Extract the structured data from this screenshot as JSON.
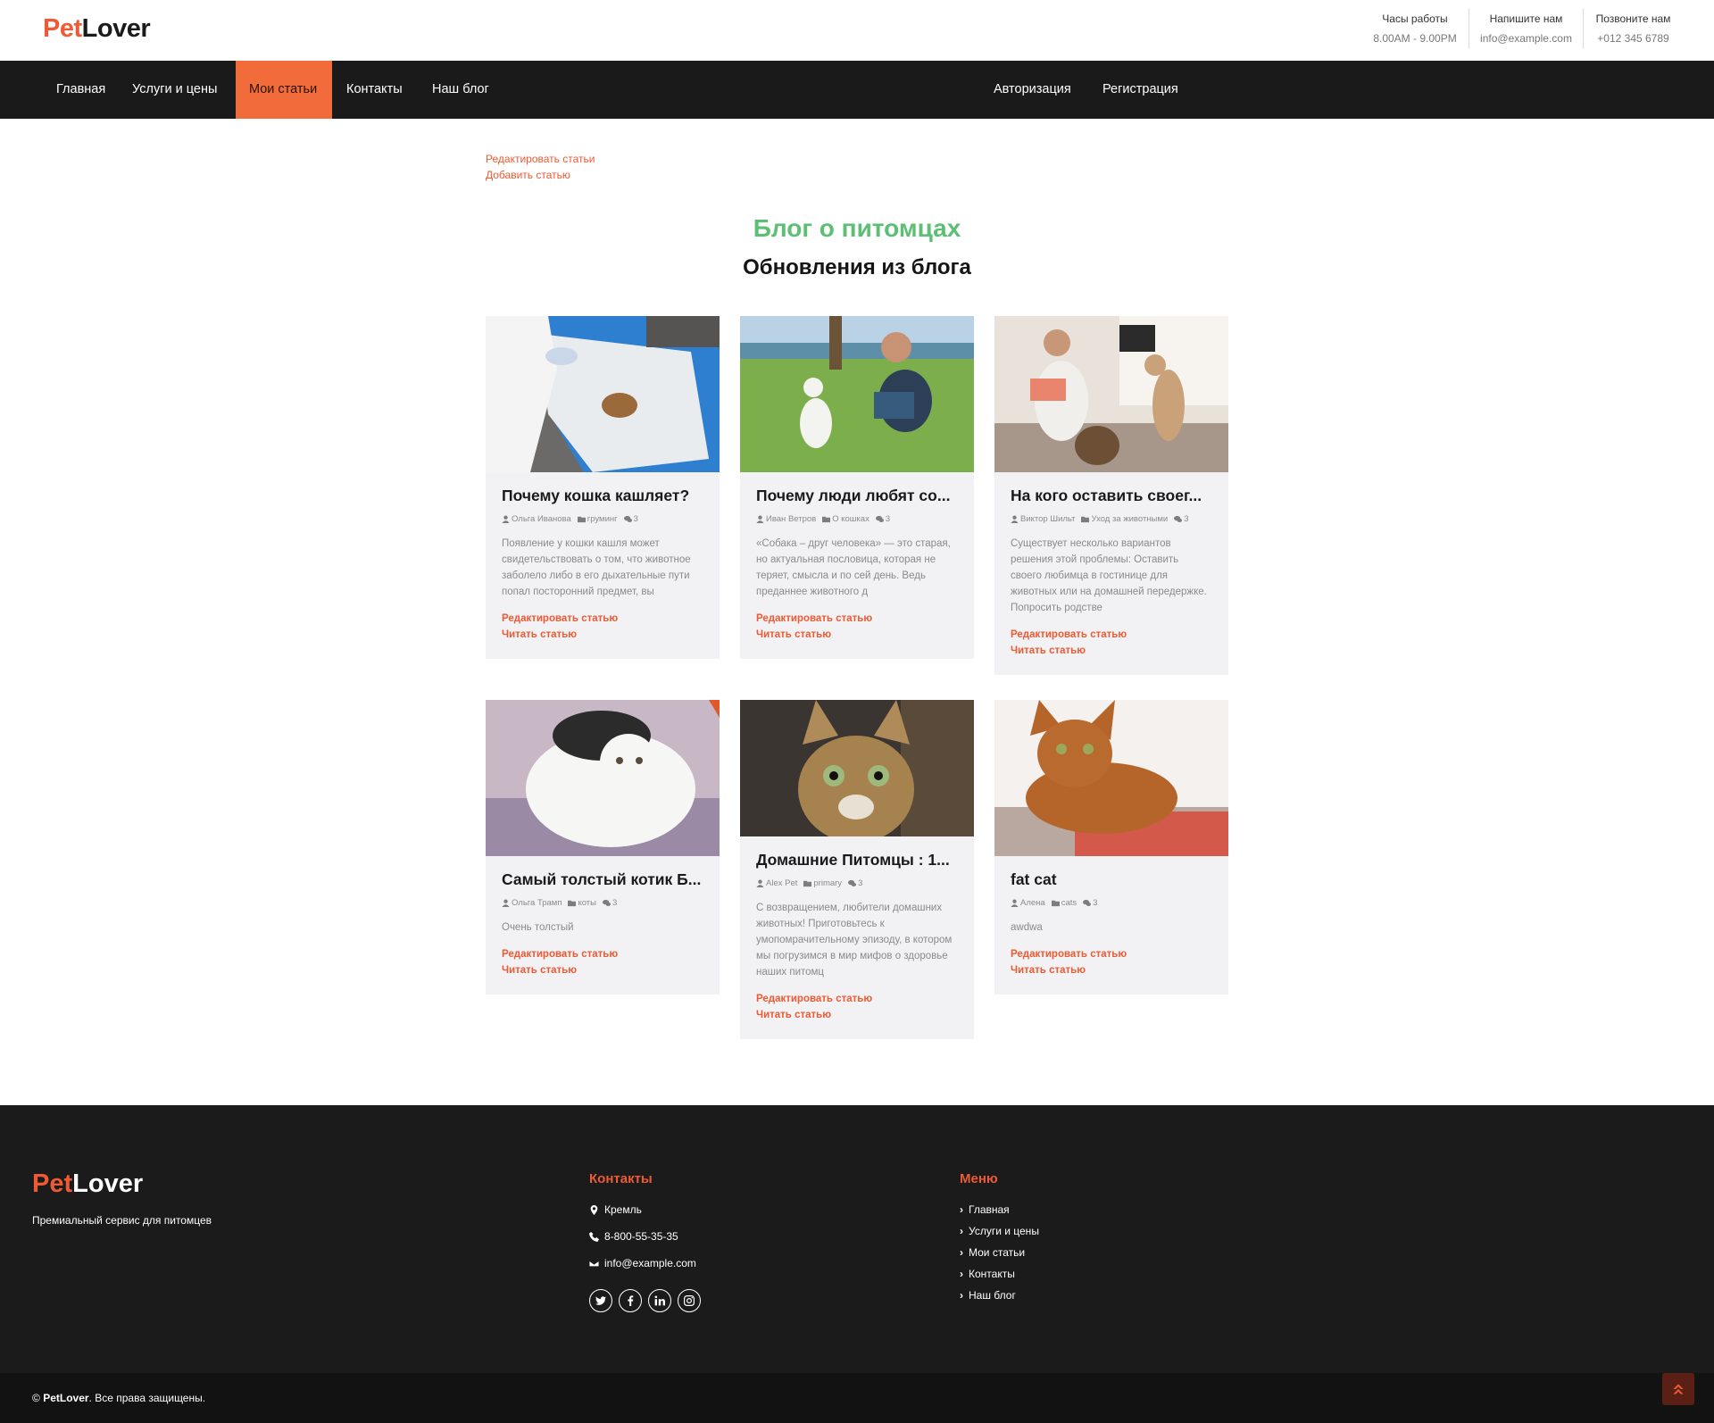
{
  "brand": {
    "pet": "Pet",
    "lover": "Lover"
  },
  "topbar": {
    "hours_label": "Часы работы",
    "hours_value": "8.00AM - 9.00PM",
    "email_label": "Напишите нам",
    "email_value": "info@example.com",
    "phone_label": "Позвоните нам",
    "phone_value": "+012 345 6789"
  },
  "nav": {
    "items": [
      {
        "label": "Главная"
      },
      {
        "label": "Услуги и цены"
      },
      {
        "label": "Мои статьи",
        "active": true
      },
      {
        "label": "Контакты"
      },
      {
        "label": "Наш блог"
      }
    ],
    "login": "Авторизация",
    "register": "Регистрация"
  },
  "admin": {
    "edit": "Редактировать статьи",
    "add": "Добавить статью"
  },
  "section": {
    "title": "Блог о питомцах",
    "subtitle": "Обновления из блога"
  },
  "cards": [
    {
      "title": "Почему кошка кашляет?",
      "author": "Ольга Иванова",
      "category": "груминг",
      "comments": "3",
      "desc": "Появление у кошки кашля может свидетельствовать о том, что животное заболело либо в его дыхательные пути попал посторонний предмет, вы",
      "edit": "Редактировать статью",
      "read": "Читать статью"
    },
    {
      "title": "Почему люди любят со...",
      "author": "Иван Ветров",
      "category": "О кошках",
      "comments": "3",
      "desc": "«Собака – друг человека» — это старая, но актуальная пословица, которая не теряет, смысла и по сей день. Ведь преданнее животного д",
      "edit": "Редактировать статью",
      "read": "Читать статью"
    },
    {
      "title": "На кого оставить своег...",
      "author": "Виктор Шильт",
      "category": "Уход за животными",
      "comments": "3",
      "desc": "Существует несколько вариантов решения этой проблемы: Оставить своего любимца в гостинице для животных или на домашней передержке. Попросить родстве",
      "edit": "Редактировать статью",
      "read": "Читать статью"
    },
    {
      "title": "Самый толстый котик Б...",
      "author": "Ольга Трамп",
      "category": "коты",
      "comments": "3",
      "desc": "Очень толстый",
      "edit": "Редактировать статью",
      "read": "Читать статью"
    },
    {
      "title": "Домашние Питомцы : 1...",
      "author": "Alex Pet",
      "category": "primary",
      "comments": "3",
      "desc": "С возвращением, любители домашних животных! Приготовьтесь к умопомрачительному эпизоду, в котором мы погрузимся в мир мифов о здоровье наших питомц",
      "edit": "Редактировать статью",
      "read": "Читать статью"
    },
    {
      "title": "fat cat",
      "author": "Алена",
      "category": "cats",
      "comments": "3",
      "desc": "awdwa",
      "edit": "Редактировать статью",
      "read": "Читать статью"
    }
  ],
  "footer": {
    "tagline": "Премиальный сервис для питомцев",
    "contacts_title": "Контакты",
    "address": "Кремль",
    "phone": "8-800-55-35-35",
    "email": "info@example.com",
    "menu_title": "Меню",
    "menu": [
      "Главная",
      "Услуги и цены",
      "Мои статьи",
      "Контакты",
      "Наш блог"
    ],
    "copyright_symbol": "©",
    "copyright_brand": "PetLover",
    "copyright_text": ". Все права защищены."
  },
  "social_icons": [
    "twitter-icon",
    "facebook-icon",
    "linkedin-icon",
    "instagram-icon"
  ],
  "colors": {
    "accent": "#ee5a33",
    "nav_bg": "#1a1a1a",
    "active_nav": "#f26b3a",
    "section_title": "#5cbf74",
    "card_bg": "#f2f2f4"
  }
}
